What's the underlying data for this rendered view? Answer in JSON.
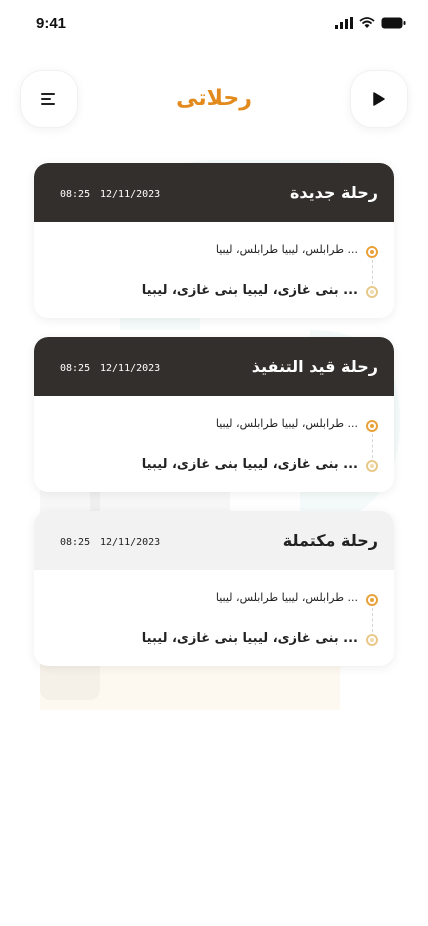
{
  "status_bar": {
    "time": "9:41"
  },
  "header": {
    "title": "رحلاتى"
  },
  "trips": [
    {
      "status": "رحلة جديدة",
      "date": "12/11/2023",
      "time": "08:25",
      "from": "... طرابلس، ليبيا طرابلس، ليبيا",
      "to": "... بنى غازى، ليبيا بنى غازى، ليبيا"
    },
    {
      "status": "رحلة قيد التنفيذ",
      "date": "12/11/2023",
      "time": "08:25",
      "from": "... طرابلس، ليبيا طرابلس، ليبيا",
      "to": "... بنى غازى، ليبيا بنى غازى، ليبيا"
    },
    {
      "status": "رحلة مكتملة",
      "date": "12/11/2023",
      "time": "08:25",
      "from": "... طرابلس، ليبيا طرابلس، ليبيا",
      "to": "... بنى غازى، ليبيا بنى غازى، ليبيا"
    }
  ],
  "colors": {
    "accent": "#e28a1c",
    "card_header_dark": "#332f2c",
    "card_header_light": "#f2f2f2",
    "pin": "#e9a23b"
  },
  "icons": {
    "menu": "menu-icon",
    "play": "play-icon",
    "signal": "signal-icon",
    "wifi": "wifi-icon",
    "battery": "battery-icon"
  }
}
